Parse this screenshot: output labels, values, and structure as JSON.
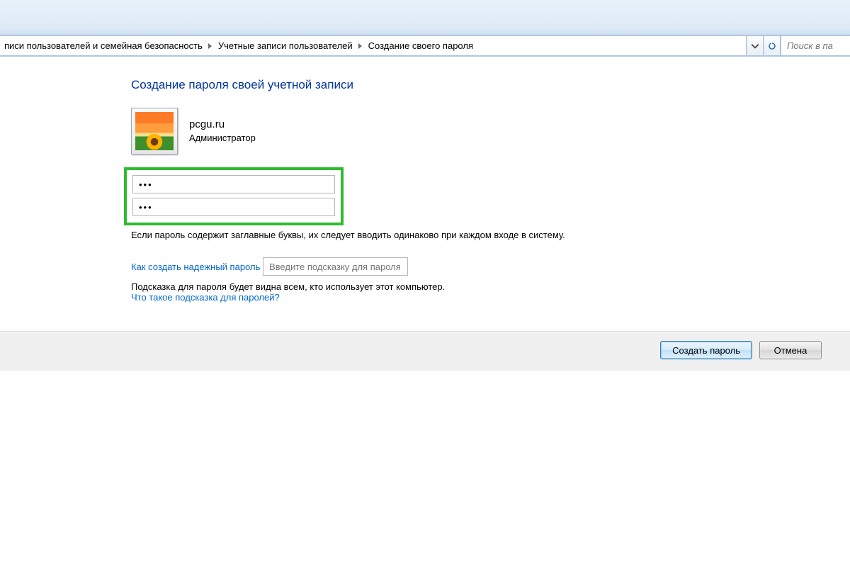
{
  "breadcrumb": {
    "items": [
      "писи пользователей и семейная безопасность",
      "Учетные записи пользователей",
      "Создание своего пароля"
    ]
  },
  "search": {
    "placeholder": "Поиск в па"
  },
  "page": {
    "title": "Создание пароля своей учетной записи"
  },
  "account": {
    "name": "pcgu.ru",
    "role": "Администратор"
  },
  "password_fields": {
    "value1": "•••",
    "value2": "•••"
  },
  "hints": {
    "caps_note": "Если пароль содержит заглавные буквы, их следует вводить одинаково при каждом входе в систему.",
    "how_to_link": "Как создать надежный пароль",
    "hint_placeholder": "Введите подсказку для пароля",
    "hint_visibility_note": "Подсказка для пароля будет видна всем, кто использует этот компьютер.",
    "what_is_hint_link": "Что такое подсказка для паролей?"
  },
  "buttons": {
    "create": "Создать пароль",
    "cancel": "Отмена"
  },
  "colors": {
    "highlight_box": "#2fbb2f",
    "title": "#003399",
    "link": "#0066cc"
  }
}
